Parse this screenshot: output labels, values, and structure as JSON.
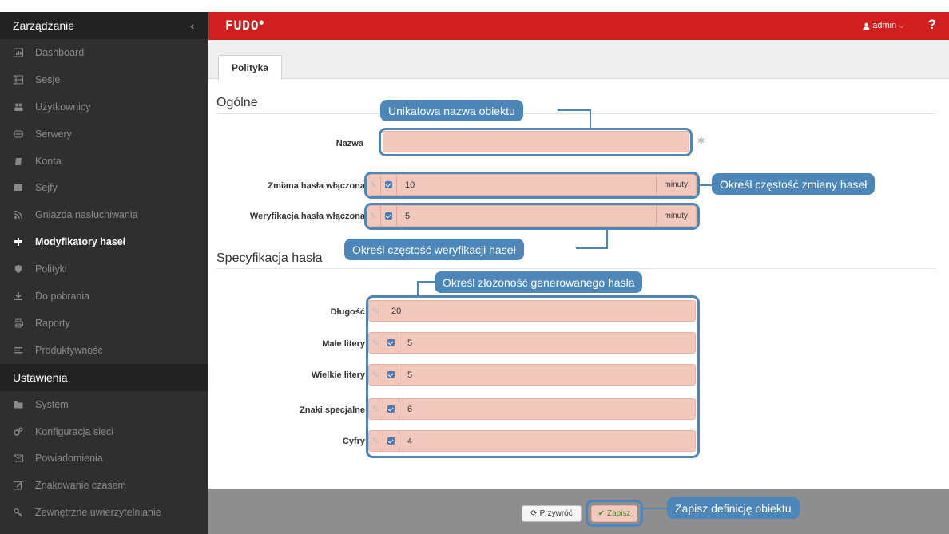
{
  "sidebar": {
    "section_manage": "Zarządzanie",
    "collapse_icon": "‹",
    "items": [
      {
        "label": "Dashboard",
        "icon": "dashboard-icon"
      },
      {
        "label": "Sesje",
        "icon": "film-icon"
      },
      {
        "label": "Użytkownicy",
        "icon": "users-icon"
      },
      {
        "label": "Serwery",
        "icon": "server-icon"
      },
      {
        "label": "Konta",
        "icon": "account-icon"
      },
      {
        "label": "Sejfy",
        "icon": "safe-icon"
      },
      {
        "label": "Gniazda nasłuchiwania",
        "icon": "rss-icon"
      },
      {
        "label": "Modyfikatory haseł",
        "icon": "password-modifier-icon"
      },
      {
        "label": "Polityki",
        "icon": "shield-icon"
      },
      {
        "label": "Do pobrania",
        "icon": "download-icon"
      },
      {
        "label": "Raporty",
        "icon": "print-icon"
      },
      {
        "label": "Produktywność",
        "icon": "productivity-icon"
      }
    ],
    "section_settings": "Ustawienia",
    "settings_items": [
      {
        "label": "System",
        "icon": "folder-icon"
      },
      {
        "label": "Konfiguracja sieci",
        "icon": "cogs-icon"
      },
      {
        "label": "Powiadomienia",
        "icon": "envelope-icon"
      },
      {
        "label": "Znakowanie czasem",
        "icon": "edit-icon"
      },
      {
        "label": "Zewnętrzne uwierzytelnianie",
        "icon": "key-icon"
      }
    ],
    "active_item": "Modyfikatory haseł",
    "colors": {
      "background": "#2f2f2f",
      "section": "#222222"
    }
  },
  "topbar": {
    "logo": "FUDO",
    "user": "admin",
    "help": "?",
    "color": "#d11f1f"
  },
  "tabs": [
    "Polityka"
  ],
  "form": {
    "general_title": "Ogólne",
    "name_label": "Nazwa",
    "name_value": "",
    "name_required_marker": "✱",
    "change_label": "Zmiana hasła włączona",
    "change_value": "10",
    "change_unit": "minuty",
    "verify_label": "Weryfikacja hasła włączona",
    "verify_value": "5",
    "verify_unit": "minuty",
    "spec_title": "Specyfikacja hasła",
    "length_label": "Długość",
    "length_value": "20",
    "lower_label": "Małe litery",
    "lower_value": "5",
    "upper_label": "Wielkie litery",
    "upper_value": "5",
    "special_label": "Znaki specjalne",
    "special_value": "6",
    "digits_label": "Cyfry",
    "digits_value": "4",
    "field_color": "#f2c8bd"
  },
  "callouts": {
    "name": "Unikatowa nazwa obiektu",
    "change": "Określ częstość zmiany haseł",
    "verify": "Określ częstość weryfikacji haseł",
    "complexity": "Określ złożoność generowanego hasła",
    "save": "Zapisz definicję obiektu",
    "color": "#4d86b9"
  },
  "footer": {
    "restore": "Przywróć",
    "save": "Zapisz"
  }
}
